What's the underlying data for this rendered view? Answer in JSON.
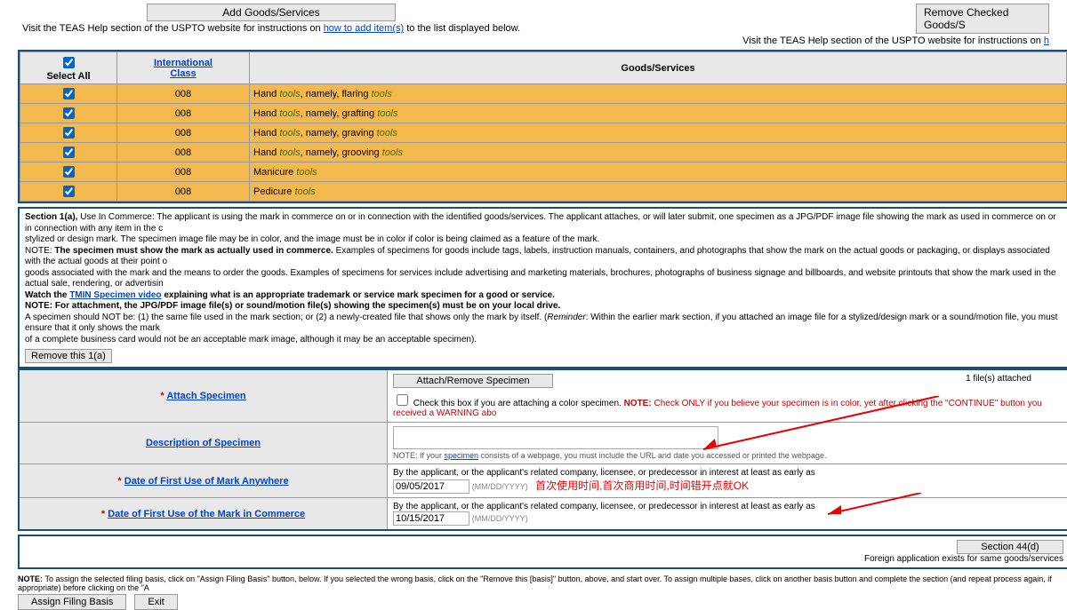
{
  "top": {
    "add_label": "Add Goods/Services",
    "remove_label": "Remove Checked Goods/S",
    "help_prefix": "Visit the TEAS Help section of the USPTO website for instructions on ",
    "help_link": "how to add item(s)",
    "help_suffix": " to the list displayed below.",
    "help_right": "Visit the TEAS Help section of the USPTO website for instructions on "
  },
  "table": {
    "select_all": "Select All",
    "intl_class_1": "International",
    "intl_class_2": "Class",
    "goods_header": "Goods/Services",
    "rows": [
      {
        "class": "008",
        "p1": "Hand ",
        "i1": "tools",
        "p2": ", namely, flaring ",
        "i2": "tools"
      },
      {
        "class": "008",
        "p1": "Hand ",
        "i1": "tools",
        "p2": ", namely, grafting ",
        "i2": "tools"
      },
      {
        "class": "008",
        "p1": "Hand ",
        "i1": "tools",
        "p2": ", namely, graving ",
        "i2": "tools"
      },
      {
        "class": "008",
        "p1": "Hand ",
        "i1": "tools",
        "p2": ", namely, grooving ",
        "i2": "tools"
      },
      {
        "class": "008",
        "p1": "Manicure ",
        "i1": "tools",
        "p2": "",
        "i2": ""
      },
      {
        "class": "008",
        "p1": "Pedicure ",
        "i1": "tools",
        "p2": "",
        "i2": ""
      }
    ]
  },
  "section1a": {
    "heading": "Section 1(a), ",
    "l1": "Use In Commerce: The applicant is using the mark in commerce on or in connection with the identified goods/services. The applicant attaches, or will later submit, one specimen as a JPG/PDF image file showing the mark as used in commerce on or in connection with any item in the c",
    "l2": "stylized or design mark. The specimen image file may be in color, and the image must be in color if color is being claimed as a feature of the mark.",
    "l3a": "NOTE: ",
    "l3b": "The specimen must show the mark as actually used in commerce. ",
    "l3c": "Examples of specimens for goods include tags, labels, instruction manuals, containers, and photographs that show the mark on the actual goods or packaging, or displays associated with the actual goods at their point o",
    "l4": "goods associated with the mark and the means to order the goods. Examples of specimens for services include advertising and marketing materials, brochures, photographs of business signage and billboards, and website printouts that show the mark used in the actual sale, rendering, or advertisin",
    "l5a": "Watch the ",
    "l5link": "TMIN Specimen video",
    "l5b": " explaining what is an appropriate trademark or service mark specimen for a good or service.",
    "l6": "NOTE: For attachment, the JPG/PDF image file(s) or sound/motion file(s) showing the specimen(s) must be on your local drive.",
    "l7a": "A specimen should NOT be: (1) the same file used in the mark section; or (2) a newly-created file that shows only the mark by itself. (",
    "l7i": "Reminder",
    "l7b": ": Within the earlier mark section, if you attached an image file for a stylized/design mark or a sound/motion file, you must ensure that it only shows the mark",
    "l8": "of a complete business card would not be an acceptable mark image, although it may be an acceptable specimen).",
    "remove_btn": "Remove this 1(a)"
  },
  "form": {
    "attach_label": "Attach Specimen",
    "attach_btn": "Attach/Remove Specimen",
    "files": "1 file(s) attached",
    "color_cb": "Check this box if you are attaching a color specimen. ",
    "color_note_bold": "NOTE: ",
    "color_note": "Check ONLY if you believe your specimen is in color, yet after clicking the \"CONTINUE\" button you received a WARNING abo",
    "desc_label": "Description of Specimen",
    "desc_note_a": "NOTE: If your ",
    "desc_note_link": "specimen",
    "desc_note_b": " consists of a webpage, you must include the URL and date you accessed or printed the webpage.",
    "anywhere_label": "Date of First Use of Mark Anywhere",
    "line_txt": "By the applicant, or the applicant's related company, licensee, or predecessor in interest at least as early as",
    "date1": "09/05/2017",
    "fmt": "(MM/DD/YYYY)",
    "annot": "首次使用时间,首次商用时间,时间错开点就OK",
    "commerce_label": "Date of First Use of the Mark in Commerce",
    "date2": "10/15/2017"
  },
  "sec44": {
    "btn": "Section 44(d)",
    "txt": "Foreign application exists for same goods/services"
  },
  "bottom": {
    "note_b": "NOTE: ",
    "note": "To assign the selected filing basis, click on \"Assign Filing Basis\" button, below. If you selected the wrong basis, click on the \"Remove this [basis]\" button, above, and start over. To assign multiple bases, click on another basis button and complete the section (and repeat process again, if appropriate) before clicking on the \"A",
    "assign": "Assign Filing Basis",
    "exit": "Exit"
  }
}
